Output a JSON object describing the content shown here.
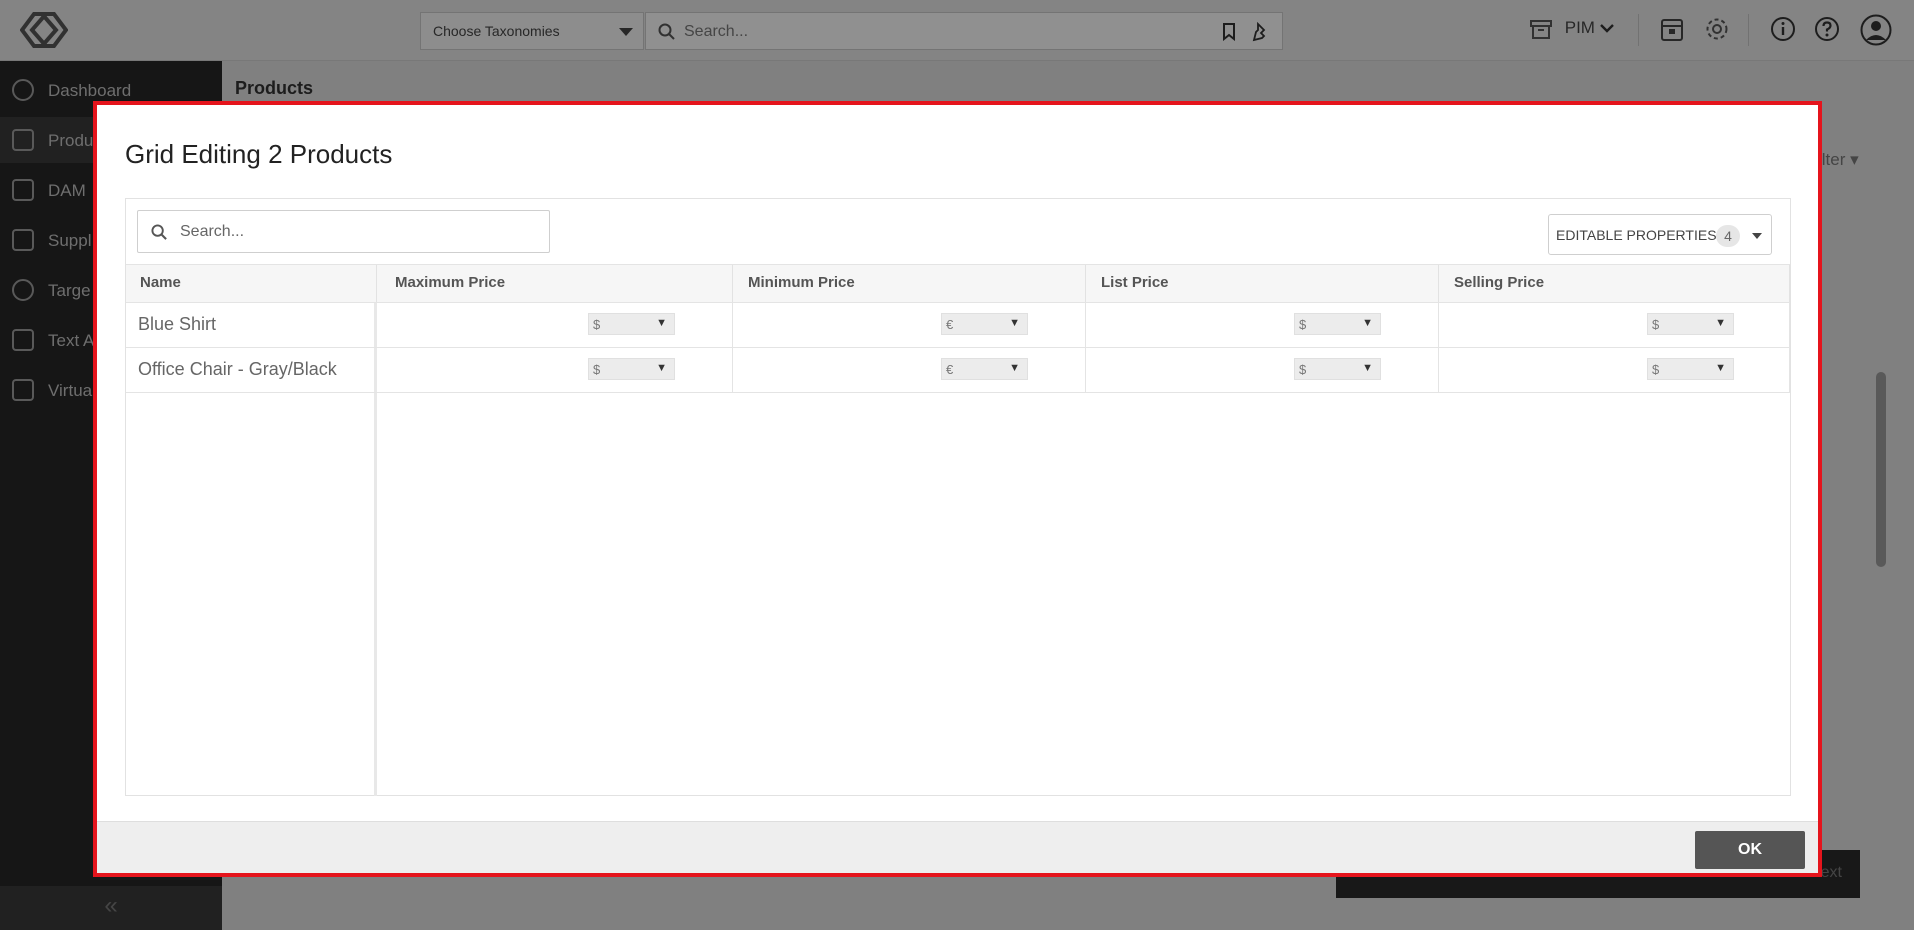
{
  "header": {
    "taxonomy_placeholder": "Choose Taxonomies",
    "search_placeholder": "Search...",
    "module_label": "PIM"
  },
  "sidebar": {
    "items": [
      {
        "label": "Dashboard"
      },
      {
        "label": "Produ"
      },
      {
        "label": "DAM"
      },
      {
        "label": "Suppl"
      },
      {
        "label": "Targe"
      },
      {
        "label": "Text A"
      },
      {
        "label": "Virtua"
      }
    ],
    "collapse_label": "«"
  },
  "main": {
    "title": "Products",
    "filter_label": "ilter ▾",
    "next_label": "ext"
  },
  "modal": {
    "title": "Grid Editing 2 Products",
    "search_placeholder": "Search...",
    "editable_label": "EDITABLE PROPERTIES",
    "editable_count": "4",
    "columns": {
      "name": "Name",
      "max_price": "Maximum Price",
      "min_price": "Minimum Price",
      "list_price": "List Price",
      "selling_price": "Selling Price"
    },
    "rows": [
      {
        "name": "Blue Shirt",
        "currencies": [
          "$",
          "€",
          "$",
          "$"
        ]
      },
      {
        "name": "Office Chair - Gray/Black",
        "currencies": [
          "$",
          "€",
          "$",
          "$"
        ]
      }
    ],
    "ok_label": "OK"
  },
  "colors": {
    "modal_border": "#e5141c",
    "sidebar_bg": "#262626",
    "ok_bg": "#555555"
  }
}
